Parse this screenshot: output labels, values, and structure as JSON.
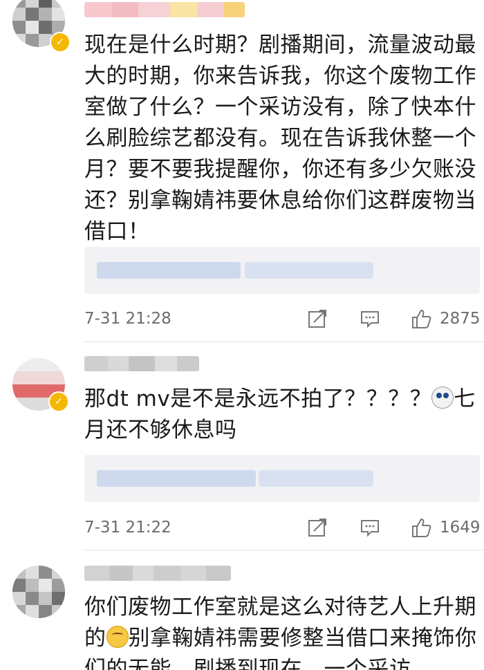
{
  "comments": [
    {
      "text": "现在是什么时期？剧播期间，流量波动最大的时期，你来告诉我，你这个废物工作室做了什么？一个采访没有，除了快本什么刷脸综艺都没有。现在告诉我休整一个月？要不要我提醒你，你还有多少欠账没还？别拿鞠婧祎要休息给你们这群废物当借口！",
      "timestamp": "7-31 21:28",
      "likes": "2875"
    },
    {
      "text_before_emoji": "那dt mv是不是永远不拍了？？？？",
      "text_after_emoji": "七月还不够休息吗",
      "timestamp": "7-31 21:22",
      "likes": "1649"
    },
    {
      "text_before_emoji": "你们废物工作室就是这么对待艺人上升期的",
      "text_after_emoji": "别拿鞠婧祎需要修整当借口来掩饰你们的无能。剧播到现在，一个采访"
    }
  ],
  "icons": {
    "share": "share-icon",
    "reply": "comment-icon",
    "like": "thumbs-up-icon",
    "verified": "verified-badge-icon"
  },
  "colors": {
    "verified_badge": "#f5b800",
    "meta_text": "#6b6b6b",
    "reply_box_bg": "#f2f2f4"
  }
}
